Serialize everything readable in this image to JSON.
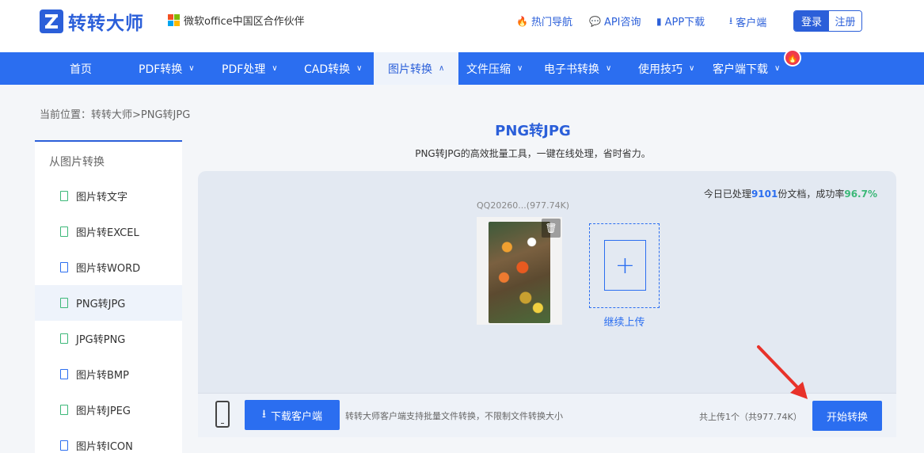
{
  "header": {
    "brand": "转转大师",
    "partner": "微软office中国区合作伙伴",
    "links": [
      {
        "label": "热门导航",
        "icon": "flame-icon"
      },
      {
        "label": "API咨询",
        "icon": "chat-icon"
      },
      {
        "label": "APP下载",
        "icon": "phone-icon"
      },
      {
        "label": "客户端",
        "icon": "download-icon"
      }
    ],
    "login_label": "登录",
    "register_label": "注册"
  },
  "nav": {
    "items": [
      {
        "label": "首页"
      },
      {
        "label": "PDF转换"
      },
      {
        "label": "PDF处理"
      },
      {
        "label": "CAD转换"
      },
      {
        "label": "图片转换"
      },
      {
        "label": "文件压缩"
      },
      {
        "label": "电子书转换"
      },
      {
        "label": "使用技巧"
      },
      {
        "label": "客户端下载"
      }
    ],
    "active": "图片转换"
  },
  "breadcrumb": "当前位置：转转大师>PNG转JPG",
  "sidebar": {
    "title": "从图片转换",
    "items": [
      {
        "label": "图片转文字"
      },
      {
        "label": "图片转EXCEL"
      },
      {
        "label": "图片转WORD"
      },
      {
        "label": "PNG转JPG"
      },
      {
        "label": "JPG转PNG"
      },
      {
        "label": "图片转BMP"
      },
      {
        "label": "图片转JPEG"
      },
      {
        "label": "图片转ICON"
      }
    ],
    "active": "PNG转JPG"
  },
  "main": {
    "title": "PNG转JPG",
    "subtitle": "PNG转JPG的高效批量工具，一键在线处理，省时省力。",
    "stats": {
      "prefix": "今日已处理",
      "count": "9101",
      "middle": "份文档，成功率",
      "rate": "96.7%"
    },
    "file": {
      "name": "QQ20260...(977.74K)"
    },
    "add_label": "继续上传"
  },
  "bottom": {
    "download_label": "下载客户端",
    "hint": "转转大师客户端支持批量文件转换，不限制文件转换大小",
    "upload_count": "共上传1个（共977.74K）",
    "start_label": "开始转换"
  },
  "colors": {
    "primary": "#2b6ef0",
    "brand": "#2b5fd9",
    "success": "#3cb878",
    "hot": "#ee3a4e"
  }
}
